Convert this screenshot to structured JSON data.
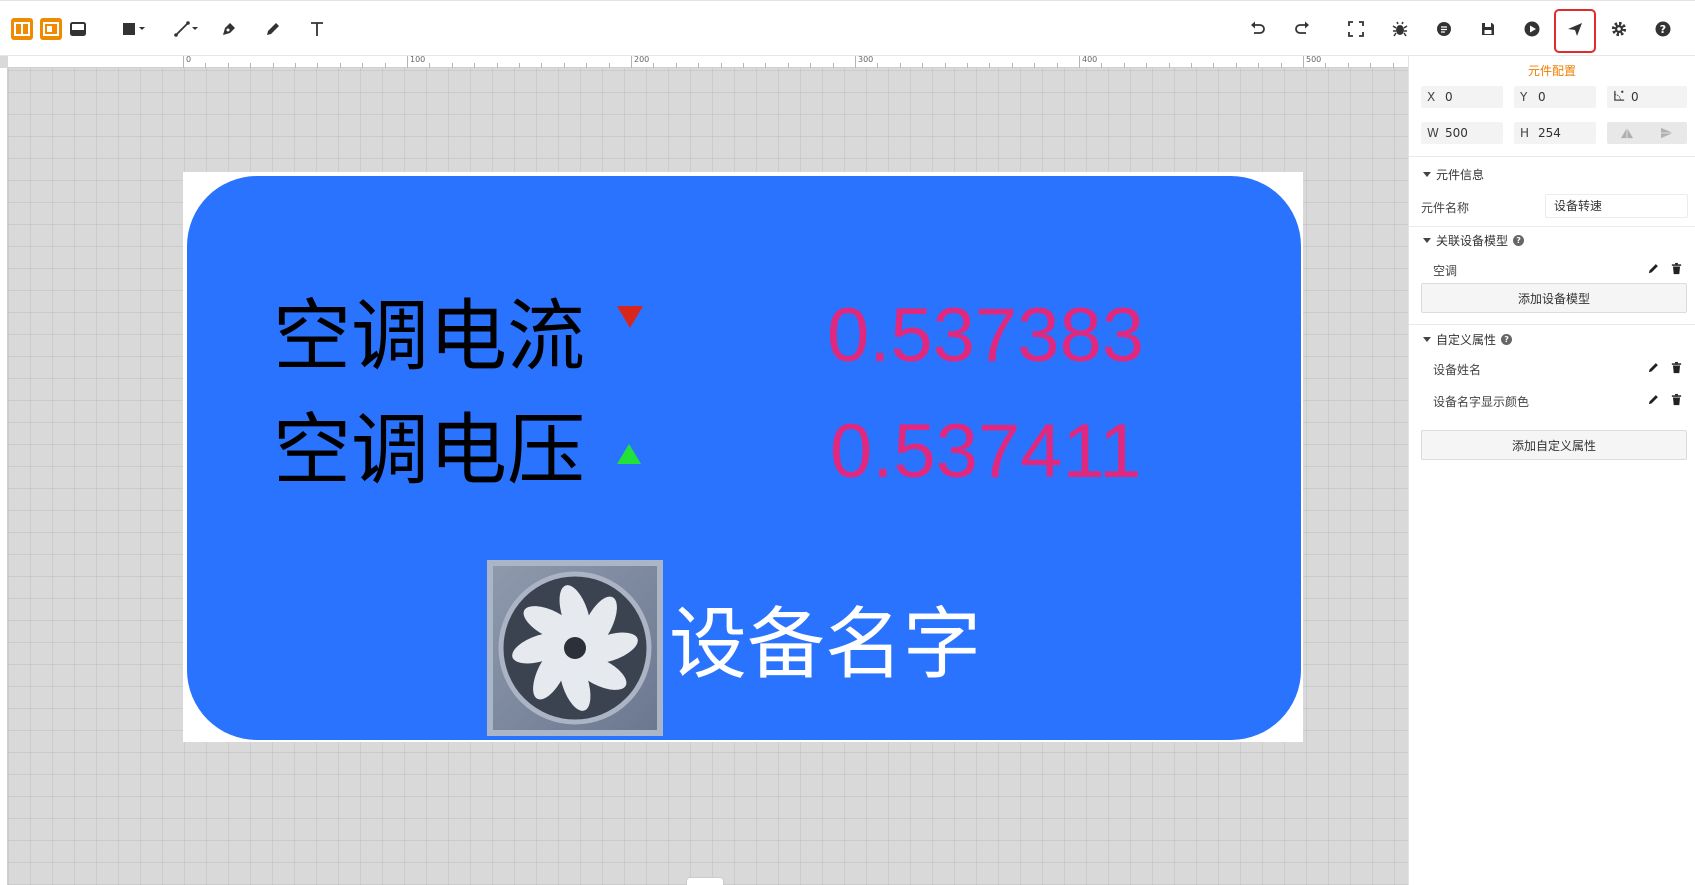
{
  "toolbar": {
    "icons": [
      "layout-split-icon",
      "layout-single-icon",
      "layout-bottom-icon",
      "rectangle-icon",
      "line-icon",
      "pen-icon",
      "pencil-icon",
      "text-icon",
      "undo-icon",
      "redo-icon",
      "fullscreen-icon",
      "bug-icon",
      "data-icon",
      "save-icon",
      "play-icon",
      "send-icon",
      "gear-icon",
      "help-icon"
    ],
    "accent_color": "#f08a00",
    "highlight_color": "#e02b2b"
  },
  "ruler": {
    "labels": [
      "0",
      "100",
      "200",
      "300",
      "400",
      "500"
    ]
  },
  "component": {
    "card_color": "#2a73ff",
    "current_label": "空调电流",
    "current_value": "0.537383",
    "current_trend": "down",
    "voltage_label": "空调电压",
    "voltage_value": "0.537411",
    "voltage_trend": "up",
    "device_name": "设备名字",
    "value_color": "#e0287e"
  },
  "panel": {
    "title": "元件配置",
    "x_label": "X",
    "x_value": "0",
    "y_label": "Y",
    "y_value": "0",
    "angle_value": "0",
    "w_label": "W",
    "w_value": "500",
    "h_label": "H",
    "h_value": "254",
    "info_section": "元件信息",
    "name_label": "元件名称",
    "name_value": "设备转速",
    "model_section": "关联设备模型",
    "model_item": "空调",
    "add_model_button": "添加设备模型",
    "custom_section": "自定义属性",
    "custom_items": [
      "设备姓名",
      "设备名字显示颜色"
    ],
    "add_custom_button": "添加自定义属性"
  }
}
